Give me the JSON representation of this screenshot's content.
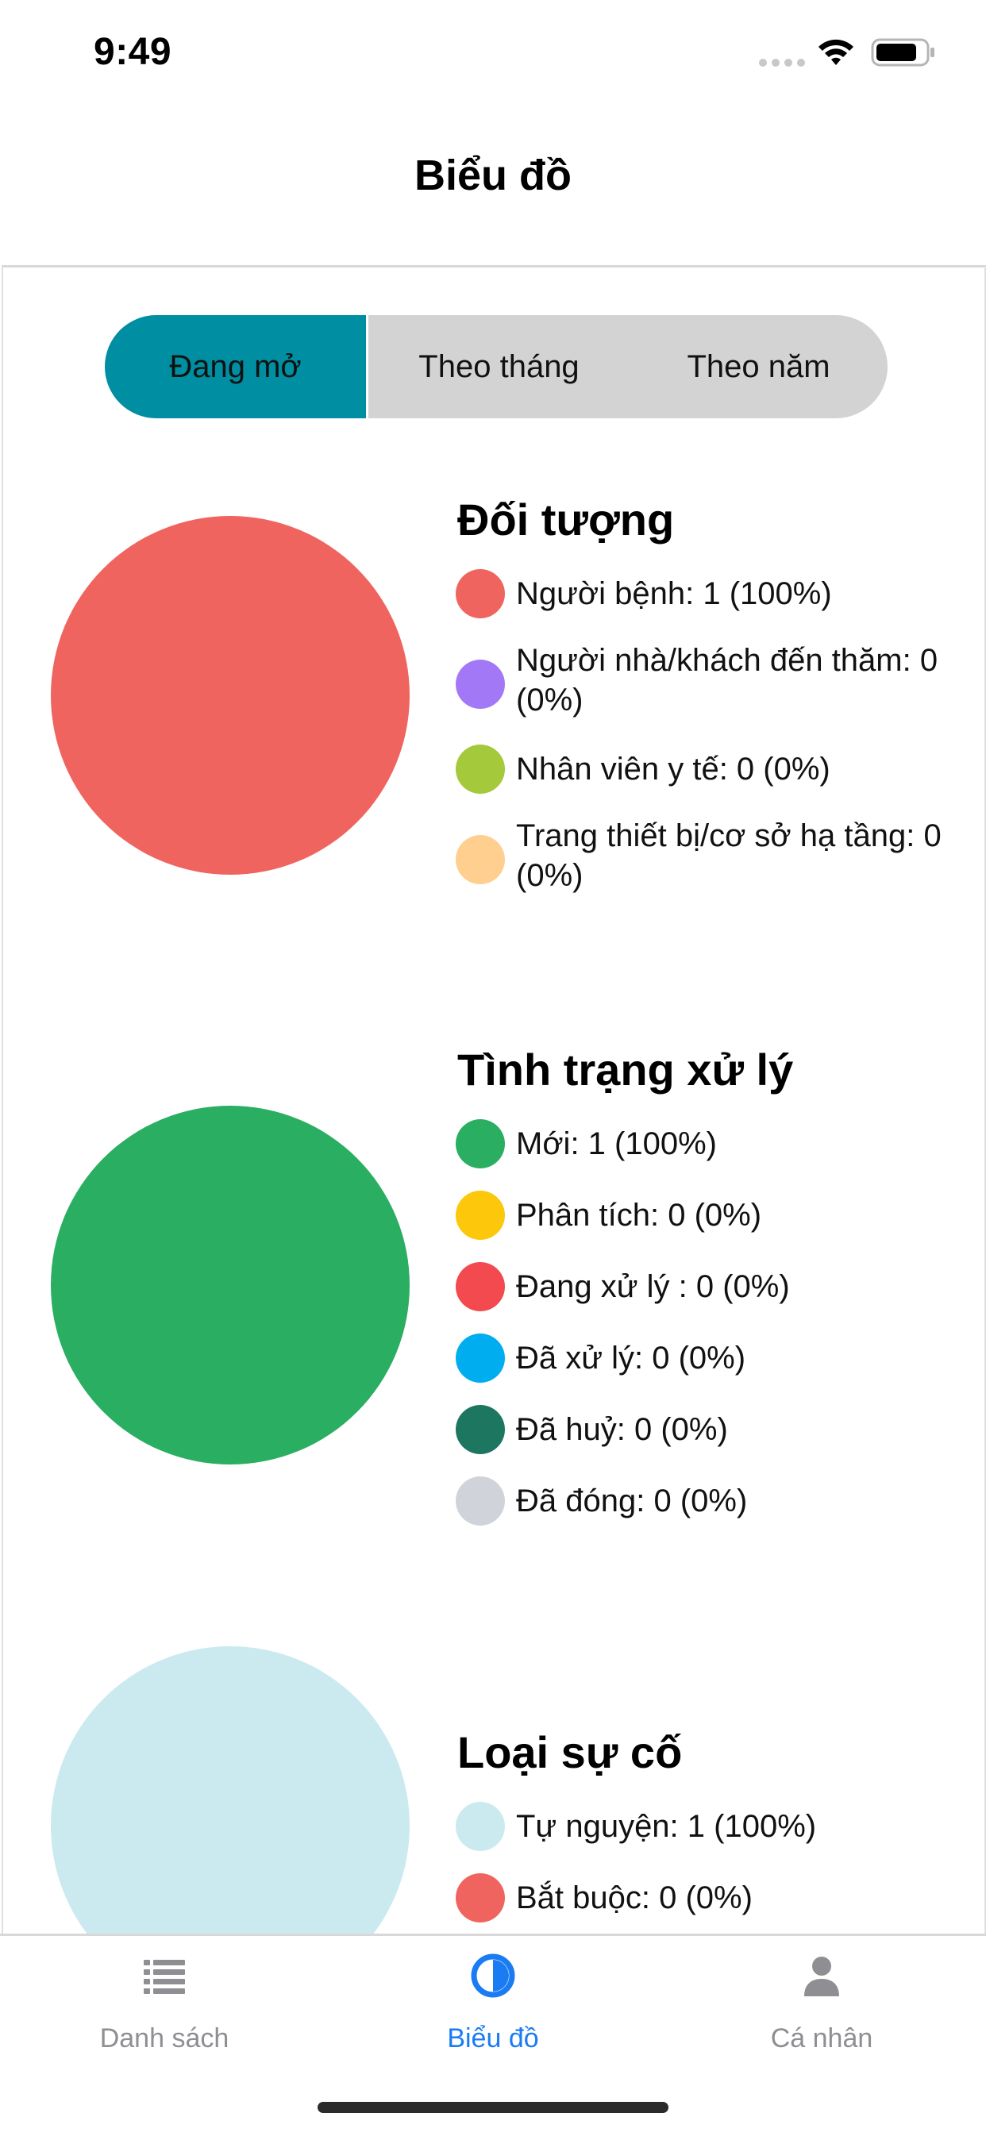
{
  "status_bar": {
    "time": "9:49"
  },
  "nav": {
    "title": "Biểu đồ"
  },
  "segments": [
    {
      "label": "Đang mở",
      "active": true
    },
    {
      "label": "Theo tháng",
      "active": false
    },
    {
      "label": "Theo năm",
      "active": false
    }
  ],
  "sections": [
    {
      "title": "Đối tượng",
      "chart_data": {
        "type": "pie",
        "title": "Đối tượng",
        "categories": [
          "Người bệnh",
          "Người nhà/khách đến thăm",
          "Nhân viên y tế",
          "Trang thiết bị/cơ sở hạ tầng"
        ],
        "values": [
          1,
          0,
          0,
          0
        ],
        "colors": [
          "#f0645f",
          "#a378f7",
          "#a4c93a",
          "#fecf8f"
        ]
      },
      "legend": [
        {
          "label": "Người bệnh: 1 (100%)",
          "color": "#f0645f"
        },
        {
          "label": "Người nhà/khách đến thăm: 0 (0%)",
          "color": "#a378f7"
        },
        {
          "label": "Nhân viên y tế: 0 (0%)",
          "color": "#a4c93a"
        },
        {
          "label": "Trang thiết bị/cơ sở hạ tầng: 0 (0%)",
          "color": "#fecf8f"
        }
      ]
    },
    {
      "title": "Tình trạng xử lý",
      "chart_data": {
        "type": "pie",
        "title": "Tình trạng xử lý",
        "categories": [
          "Mới",
          "Phân tích",
          "Đang xử lý",
          "Đã xử lý",
          "Đã huỷ",
          "Đã đóng"
        ],
        "values": [
          1,
          0,
          0,
          0,
          0,
          0
        ],
        "colors": [
          "#2aae61",
          "#fdc70b",
          "#f34a4f",
          "#00adef",
          "#1d7760",
          "#d0d4da"
        ]
      },
      "legend": [
        {
          "label": "Mới: 1 (100%)",
          "color": "#2aae61"
        },
        {
          "label": "Phân tích: 0 (0%)",
          "color": "#fdc70b"
        },
        {
          "label": "Đang xử lý : 0 (0%)",
          "color": "#f34a4f"
        },
        {
          "label": "Đã xử lý: 0 (0%)",
          "color": "#00adef"
        },
        {
          "label": "Đã huỷ: 0 (0%)",
          "color": "#1d7760"
        },
        {
          "label": "Đã đóng: 0 (0%)",
          "color": "#d0d4da"
        }
      ]
    },
    {
      "title": "Loại sự cố",
      "chart_data": {
        "type": "pie",
        "title": "Loại sự cố",
        "categories": [
          "Tự nguyện",
          "Bắt buộc"
        ],
        "values": [
          1,
          0
        ],
        "colors": [
          "#cbeaf0",
          "#f0645f"
        ]
      },
      "legend": [
        {
          "label": "Tự nguyện: 1 (100%)",
          "color": "#cbeaf0"
        },
        {
          "label": "Bắt buộc: 0 (0%)",
          "color": "#f0645f"
        }
      ]
    }
  ],
  "tab_bar": {
    "items": [
      {
        "label": "Danh sách",
        "icon": "list-icon",
        "active": false
      },
      {
        "label": "Biểu đồ",
        "icon": "chart-icon",
        "active": true
      },
      {
        "label": "Cá nhân",
        "icon": "person-icon",
        "active": false
      }
    ],
    "active_color": "#1a7cf2",
    "inactive_color": "#8e8e93"
  }
}
